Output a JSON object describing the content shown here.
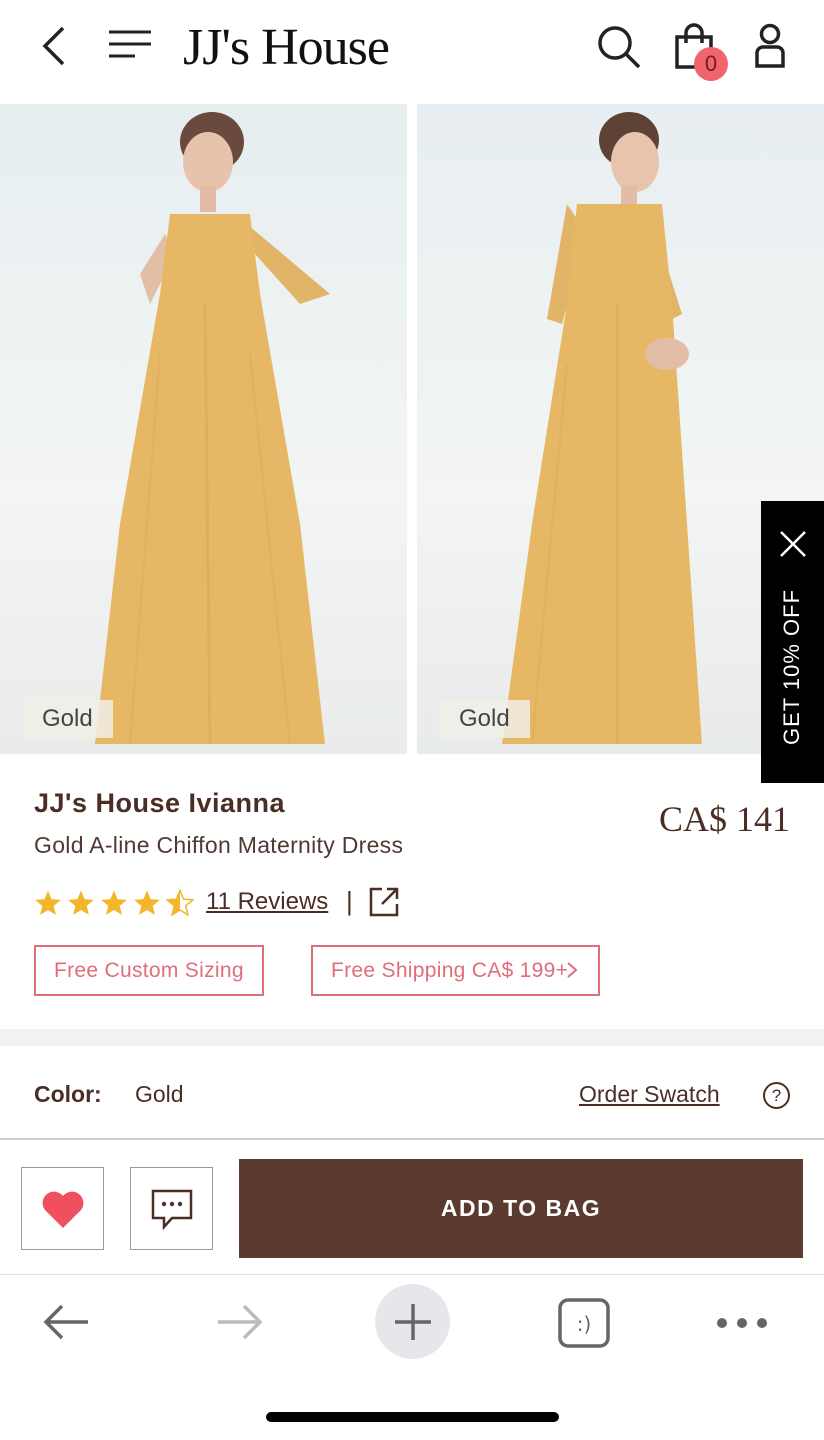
{
  "header": {
    "logo": "JJ's House",
    "cart_count": "0",
    "icons": [
      "back-icon",
      "menu-icon",
      "search-icon",
      "shopping-bag-icon",
      "user-icon"
    ]
  },
  "gallery": {
    "images": [
      {
        "tag": "Gold"
      },
      {
        "tag": "Gold"
      }
    ]
  },
  "promo": {
    "label": "GET 10% OFF"
  },
  "product": {
    "brand": "JJ's House Ivianna",
    "name": "Gold A-line Chiffon Maternity Dress",
    "price": "CA$ 141",
    "rating": 4.5,
    "rating_max": 5,
    "reviews": "11 Reviews",
    "pipe": "|",
    "badges": {
      "custom": "Free Custom Sizing",
      "shipping": "Free Shipping CA$ 199+"
    }
  },
  "color_row": {
    "label": "Color:",
    "value": "Gold",
    "swatch": "Order Swatch",
    "help": "?"
  },
  "actions": {
    "add_to_bag": "ADD TO BAG"
  },
  "colors": {
    "brown": "#5b3a30",
    "pink": "#e06d7a",
    "star": "#f3b52a",
    "heart": "#f04f5e",
    "dress": "#e6b866"
  }
}
